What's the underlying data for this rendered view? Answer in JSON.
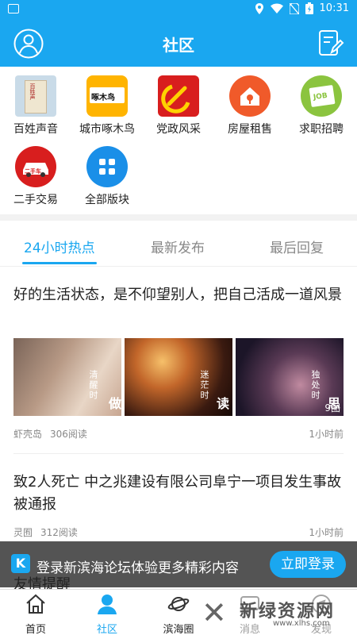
{
  "status_bar": {
    "time": "10:31"
  },
  "header": {
    "title": "社区"
  },
  "categories": [
    {
      "label": "百姓声音",
      "icon": "voice-stele-icon",
      "logo_text": "百姓声"
    },
    {
      "label": "城市啄木鸟",
      "icon": "woodpecker-icon",
      "logo_text": "啄木鸟"
    },
    {
      "label": "党政风采",
      "icon": "party-emblem-icon"
    },
    {
      "label": "房屋租售",
      "icon": "house-key-icon"
    },
    {
      "label": "求职招聘",
      "icon": "job-icon",
      "logo_text": "JOB"
    },
    {
      "label": "二手交易",
      "icon": "car-icon",
      "logo_text": "二手车"
    },
    {
      "label": "全部版块",
      "icon": "grid-icon"
    }
  ],
  "tabs": [
    {
      "label": "24小时热点",
      "active": true
    },
    {
      "label": "最新发布",
      "active": false
    },
    {
      "label": "最后回复",
      "active": false
    }
  ],
  "posts": [
    {
      "title": "好的生活状态，是不仰望别人，把自己活成一道风景",
      "thumbs": [
        {
          "small": "清醒时",
          "big": "做"
        },
        {
          "small": "迷茫时",
          "big": "读"
        },
        {
          "small": "独处时",
          "big": "思"
        }
      ],
      "image_count": "9图",
      "source": "虾壳岛",
      "reads": "306阅读",
      "time": "1小时前"
    },
    {
      "title": "致2人死亡 中之兆建设有限公司阜宁一项目发生事故被通报",
      "source": "灵囿",
      "reads": "312阅读",
      "time": "1小时前"
    }
  ],
  "login_banner": {
    "text": "登录新滨海论坛体验更多精彩内容",
    "button": "立即登录",
    "icon_letter": "K"
  },
  "partial_text": "友情提醒",
  "bottom_nav": [
    {
      "label": "首页",
      "icon": "home-icon",
      "active": false
    },
    {
      "label": "社区",
      "icon": "community-icon",
      "active": true
    },
    {
      "label": "滨海圈",
      "icon": "planet-icon",
      "active": false
    },
    {
      "label": "消息",
      "icon": "message-icon",
      "active": false
    },
    {
      "label": "发现",
      "icon": "discover-icon",
      "active": false
    }
  ],
  "watermark": {
    "main": "新绿资源网",
    "sub": "www.xlhs.com"
  },
  "colors": {
    "accent": "#1aa7f0",
    "banner": "#3c3c3c",
    "muted": "#888888"
  }
}
